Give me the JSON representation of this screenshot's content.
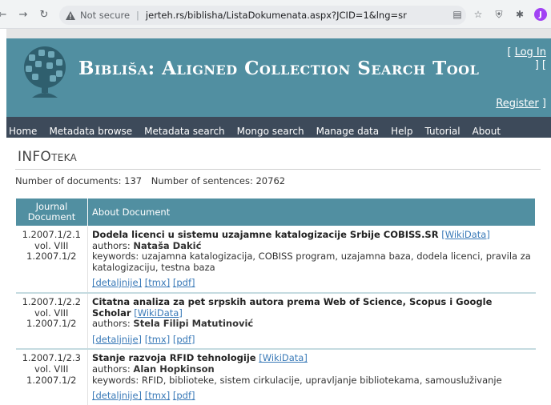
{
  "browser": {
    "security_label": "Not secure",
    "url": "jerteh.rs/biblisha/ListaDokumenata.aspx?JCID=1&lng=sr",
    "profile_initial": "J"
  },
  "header": {
    "title": "Bibliša: Aligned Collection Search Tool",
    "login_label": "Log In",
    "register_label": "Register"
  },
  "menu": [
    "Home",
    "Metadata browse",
    "Metadata search",
    "Mongo search",
    "Manage data",
    "Help",
    "Tutorial",
    "About"
  ],
  "page": {
    "heading": "INFOteka",
    "doc_count_label": "Number of documents: 137",
    "sentence_count_label": "Number of sentences: 20762"
  },
  "table": {
    "col1_header": "Journal Document",
    "col2_header": "About Document",
    "rows": [
      {
        "ref1": "1.2007.1/2.1",
        "ref2": "vol. VIII",
        "ref3": "1.2007.1/2",
        "title": "Dodela licenci u sistemu uzajamne katalogizacije Srbije COBISS.SR",
        "wikidata": "[WikiData]",
        "authors_label": "authors:",
        "authors": "Nataša Dakić",
        "keywords_label": "keywords:",
        "keywords": "uzajamna katalogizacija, COBISS program, uzajamna baza, dodela licenci, pravila za katalogizaciju, testna baza",
        "link1": "[detaljnije]",
        "link2": "[tmx]",
        "link3": "[pdf]"
      },
      {
        "ref1": "1.2007.1/2.2",
        "ref2": "vol. VIII",
        "ref3": "1.2007.1/2",
        "title": "Citatna analiza za pet srpskih autora prema Web of Science, Scopus i Google Scholar",
        "wikidata": "[WikiData]",
        "authors_label": "authors:",
        "authors": "Stela Filipi Matutinović",
        "link1": "[detaljnije]",
        "link2": "[tmx]",
        "link3": "[pdf]"
      },
      {
        "ref1": "1.2007.1/2.3",
        "ref2": "vol. VIII",
        "ref3": "1.2007.1/2",
        "title": "Stanje razvoja RFID tehnologije",
        "wikidata": "[WikiData]",
        "authors_label": "authors:",
        "authors": "Alan Hopkinson",
        "keywords_label": "keywords:",
        "keywords": "RFID, biblioteke, sistem cirkulacije, upravljanje bibliotekama, samousluživanje",
        "link1": "[detaljnije]",
        "link2": "[tmx]",
        "link3": "[pdf]"
      }
    ]
  },
  "colors": {
    "banner": "#518fa1",
    "menubar": "#3d4a5a",
    "link": "#3a7ab8"
  }
}
